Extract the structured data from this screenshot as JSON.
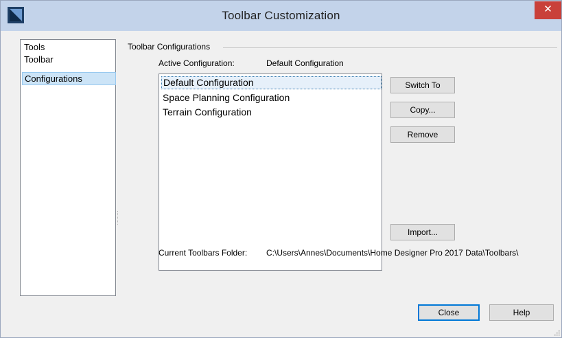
{
  "window": {
    "title": "Toolbar Customization",
    "close_label": "✕"
  },
  "nav": {
    "items": [
      {
        "label": "Tools"
      },
      {
        "label": "Toolbar"
      },
      {
        "label": "Configurations",
        "selected": true
      }
    ]
  },
  "configurations": {
    "group_label": "Toolbar Configurations",
    "active_label": "Active Configuration:",
    "active_value": "Default Configuration",
    "list": [
      {
        "label": "Default Configuration",
        "selected": true
      },
      {
        "label": "Space Planning Configuration"
      },
      {
        "label": "Terrain Configuration"
      }
    ],
    "buttons": {
      "switch_to": "Switch To",
      "copy": "Copy...",
      "remove": "Remove",
      "import": "Import..."
    },
    "folder_label": "Current Toolbars Folder:",
    "folder_path": "C:\\Users\\Annes\\Documents\\Home Designer Pro 2017 Data\\Toolbars\\"
  },
  "footer": {
    "close": "Close",
    "help": "Help"
  },
  "colors": {
    "titlebar": "#c3d3ea",
    "close_button": "#c9403a",
    "selection": "#cce4f7",
    "default_button_border": "#0078d7"
  }
}
